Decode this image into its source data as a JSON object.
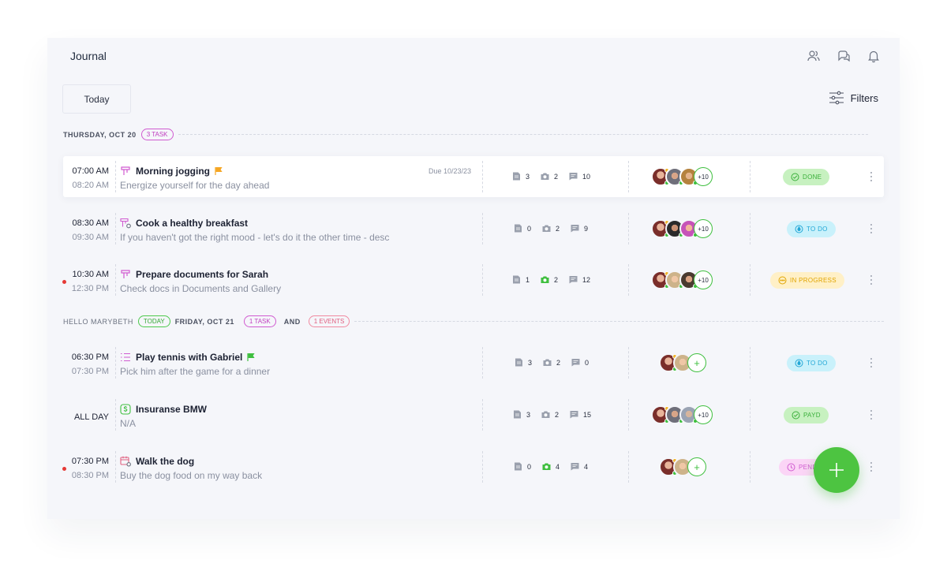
{
  "app": {
    "title": "Journal"
  },
  "toolbar": {
    "today_label": "Today",
    "filters_label": "Filters"
  },
  "groups": [
    {
      "day_label": "THURSDAY, OCT 20",
      "count_pill": "3 TASK"
    },
    {
      "greeting": "HELLO MARYBETH",
      "today_pill": "TODAY",
      "day_label": "FRIDAY, OCT 21",
      "task_pill": "1 TASK",
      "and_label": "AND",
      "event_pill": "1 EVENTS"
    }
  ],
  "rows": [
    {
      "start": "07:00 AM",
      "end": "08:20 AM",
      "title": "Morning jogging",
      "desc": "Energize yourself for the day ahead",
      "due": "Due 10/23/23",
      "docs": "3",
      "photos": "2",
      "comments": "10",
      "more_avatars": "+10",
      "status": "DONE",
      "icon": "tasks-icon",
      "flag_color": "#f5a623",
      "status_color": "#3aaf3a"
    },
    {
      "start": "08:30 AM",
      "end": "09:30 AM",
      "title": "Cook a healthy breakfast",
      "desc": "If you haven't got the right mood - let's do it the other time - desc",
      "docs": "0",
      "photos": "2",
      "comments": "9",
      "more_avatars": "+10",
      "status": "TO DO",
      "icon": "recurring-tasks-icon",
      "status_color": "#22a7d6"
    },
    {
      "start": "10:30 AM",
      "end": "12:30 PM",
      "title": "Prepare documents for Sarah",
      "desc": "Check docs in Documents and Gallery",
      "docs": "1",
      "photos": "2",
      "comments": "12",
      "more_avatars": "+10",
      "status": "IN PROGRESS",
      "icon": "tasks-icon",
      "status_color": "#e0a400"
    },
    {
      "start": "06:30 PM",
      "end": "07:30 PM",
      "title": "Play tennis with Gabriel",
      "desc": "Pick him after the game for a dinner",
      "docs": "3",
      "photos": "2",
      "comments": "0",
      "status": "TO DO",
      "icon": "checklist-icon",
      "flag_color": "#3fbf3f",
      "status_color": "#22a7d6"
    },
    {
      "start": "ALL DAY",
      "title": "Insuranse BMW",
      "desc": "N/A",
      "docs": "3",
      "photos": "2",
      "comments": "15",
      "more_avatars": "+10",
      "status": "PAYD",
      "icon": "payment-icon",
      "status_color": "#3aaf3a"
    },
    {
      "start": "07:30 PM",
      "end": "08:30 PM",
      "title": "Walk the dog",
      "desc": "Buy the dog food on my way back",
      "docs": "0",
      "photos": "4",
      "comments": "4",
      "status": "PEND",
      "icon": "recurring-event-icon",
      "status_color": "#d05bd0"
    }
  ]
}
